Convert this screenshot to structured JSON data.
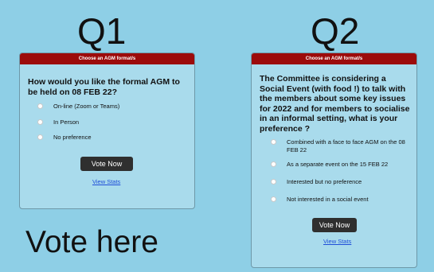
{
  "labels": {
    "q1": "Q1",
    "q2": "Q2",
    "vote_here": "Vote here"
  },
  "poll1": {
    "header": "Choose an AGM format/s",
    "question": "How would you like the formal AGM to be held on 08 FEB 22?",
    "options": [
      "On-line (Zoom or Teams)",
      "In Person",
      "No preference"
    ],
    "vote_button": "Vote Now",
    "stats_link": "View Stats"
  },
  "poll2": {
    "header": "Choose an AGM format/s",
    "question": "The Committee is considering a Social Event (with food !) to talk with the members about some key issues for 2022 and for members to socialise in an informal setting, what is your preference ?",
    "options": [
      "Combined with a face to face AGM on the 08 FEB 22",
      "As a separate event on the 15 FEB 22",
      "Interested but no preference",
      "Not interested in a social event"
    ],
    "vote_button": "Vote Now",
    "stats_link": "View Stats"
  },
  "colors": {
    "background": "#8ecfe6",
    "panel": "#a9dbec",
    "header": "#9c0b0b",
    "button": "#2f2f2f",
    "link": "#1f4ed8"
  }
}
